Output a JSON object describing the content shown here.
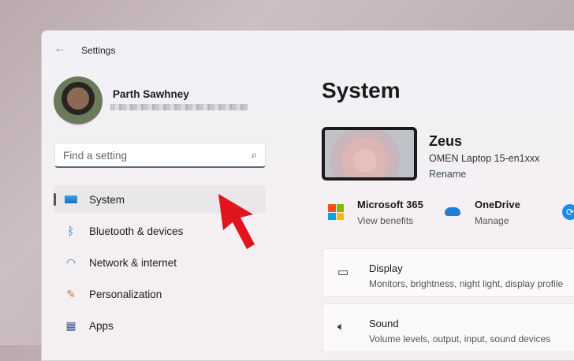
{
  "window": {
    "back_icon": "arrow-left-icon",
    "title": "Settings"
  },
  "user": {
    "name": "Parth Sawhney"
  },
  "search": {
    "placeholder": "Find a setting",
    "icon": "search-icon"
  },
  "nav": [
    {
      "label": "System",
      "icon": "monitor-icon",
      "selected": true
    },
    {
      "label": "Bluetooth & devices",
      "icon": "bluetooth-icon"
    },
    {
      "label": "Network & internet",
      "icon": "wifi-icon"
    },
    {
      "label": "Personalization",
      "icon": "brush-icon"
    },
    {
      "label": "Apps",
      "icon": "apps-icon"
    }
  ],
  "main": {
    "title": "System",
    "device": {
      "name": "Zeus",
      "model": "OMEN Laptop 15-en1xxx",
      "rename": "Rename"
    },
    "quick": [
      {
        "title": "Microsoft 365",
        "sub": "View benefits"
      },
      {
        "title": "OneDrive",
        "sub": "Manage"
      }
    ],
    "cards": [
      {
        "title": "Display",
        "sub": "Monitors, brightness, night light, display profile"
      },
      {
        "title": "Sound",
        "sub": "Volume levels, output, input, sound devices"
      }
    ]
  },
  "colors": {
    "accent": "#0067c0",
    "arrow": "#e0151f"
  }
}
